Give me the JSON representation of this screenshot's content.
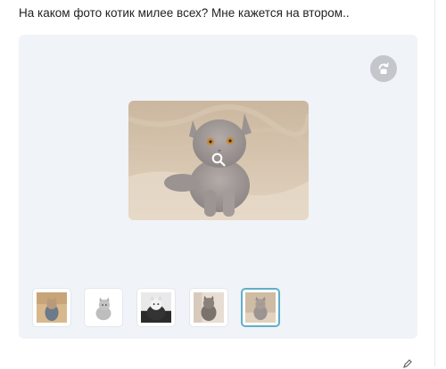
{
  "post": {
    "text": "На каком фото котик милее всех? Мне кажется на втором.."
  },
  "gallery": {
    "rotate_icon": "rotate-icon",
    "zoom_icon": "magnifier-icon",
    "selected_index": 5,
    "thumbnails": [
      {
        "name": "photo-1",
        "selected": false
      },
      {
        "name": "photo-2",
        "selected": false
      },
      {
        "name": "photo-3",
        "selected": false
      },
      {
        "name": "photo-4",
        "selected": false
      },
      {
        "name": "photo-5",
        "selected": true
      }
    ]
  },
  "colors": {
    "accent_selected": "#5fb0c8",
    "gallery_bg": "#f0f3f7"
  }
}
